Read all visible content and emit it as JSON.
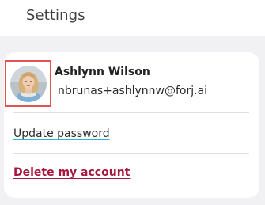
{
  "header": {
    "title": "Settings"
  },
  "profile": {
    "name": "Ashlynn Wilson",
    "email": "nbrunas+ashlynnw@forj.ai"
  },
  "actions": {
    "update_password": "Update password",
    "delete_account": "Delete my account"
  },
  "colors": {
    "link_underline": "#2bb3d6",
    "danger": "#a8163f",
    "highlight_border": "#e05353"
  },
  "icons": {
    "avatar": "user-avatar-photo"
  }
}
